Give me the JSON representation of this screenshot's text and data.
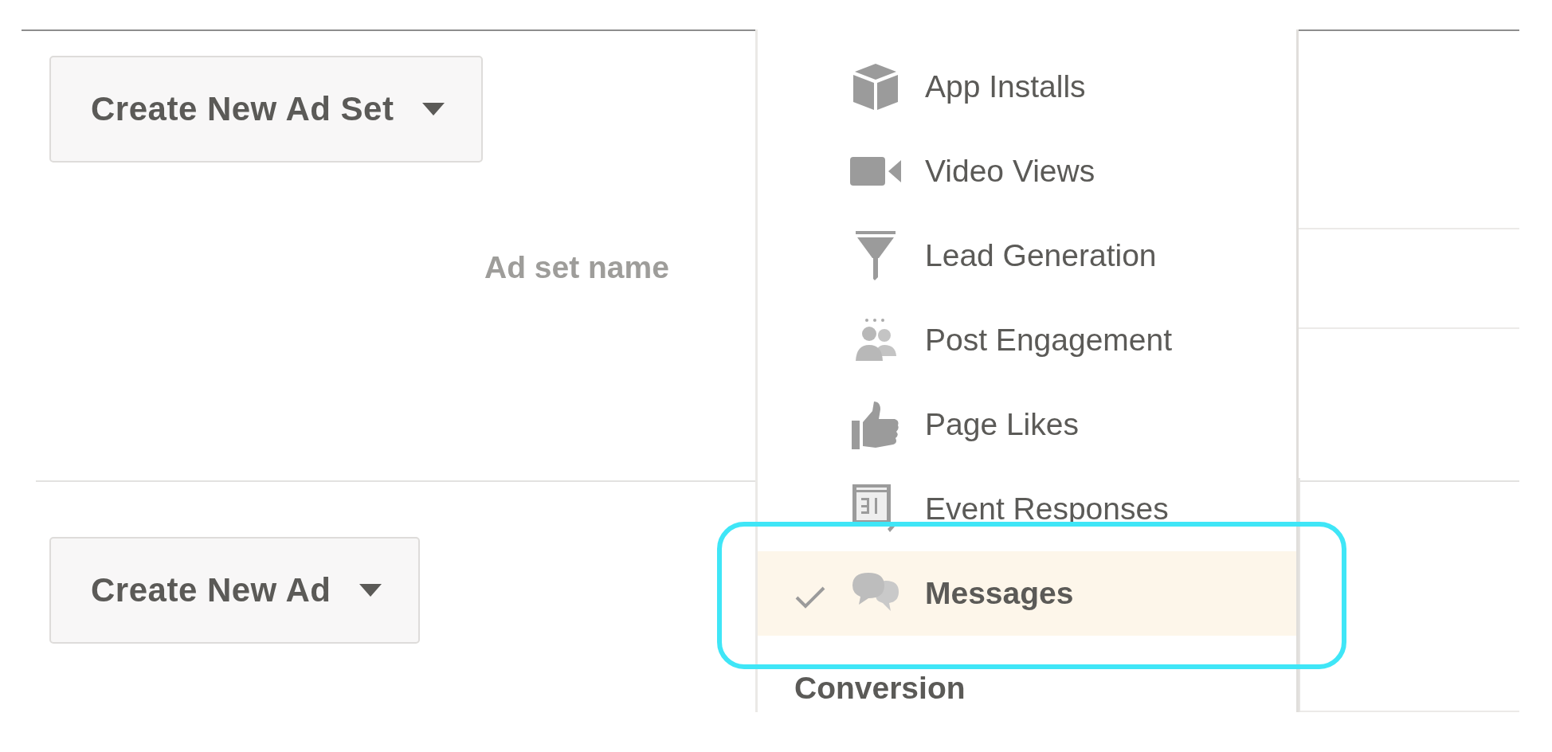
{
  "ad_set_section": {
    "create_button": "Create New Ad Set",
    "field_label": "Ad set name"
  },
  "ad_section": {
    "create_button": "Create New Ad"
  },
  "objective_menu": {
    "items": [
      {
        "label": "App Installs",
        "selected": false
      },
      {
        "label": "Video Views",
        "selected": false
      },
      {
        "label": "Lead Generation",
        "selected": false
      },
      {
        "label": "Post Engagement",
        "selected": false
      },
      {
        "label": "Page Likes",
        "selected": false
      },
      {
        "label": "Event Responses",
        "selected": false
      },
      {
        "label": "Messages",
        "selected": true
      }
    ],
    "section_header": "Conversion"
  }
}
